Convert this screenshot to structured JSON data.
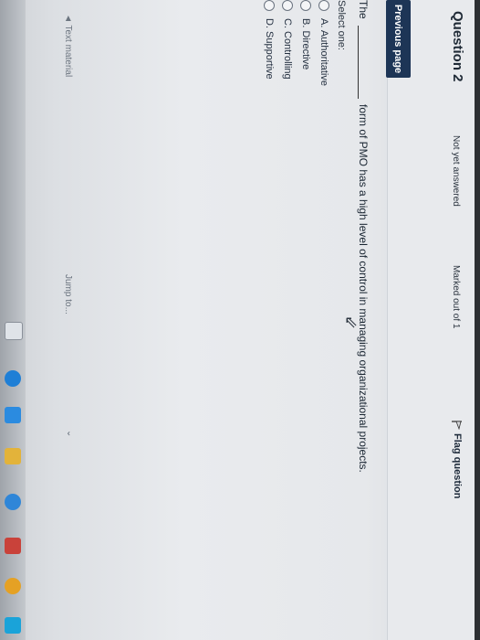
{
  "question": {
    "title": "Question 2",
    "status": "Not yet answered",
    "marks": "Marked out of 1",
    "flag_label": "Flag question"
  },
  "prompt": {
    "lead": "The",
    "rest": "form of PMO has a high level of control in managing organizational projects."
  },
  "select_label": "Select one:",
  "options": [
    "A. Authoritative",
    "B. Directive",
    "C. Controlling",
    "D. Supportive"
  ],
  "buttons": {
    "previous_page": "Previous page"
  },
  "nav": {
    "prev_link": "◄ Text material",
    "jump_to": "Jump to...",
    "caret": "⌄"
  },
  "colors": {
    "primary_button": "#1d3556",
    "page_bg": "#e9ebee",
    "text": "#1b2733"
  }
}
